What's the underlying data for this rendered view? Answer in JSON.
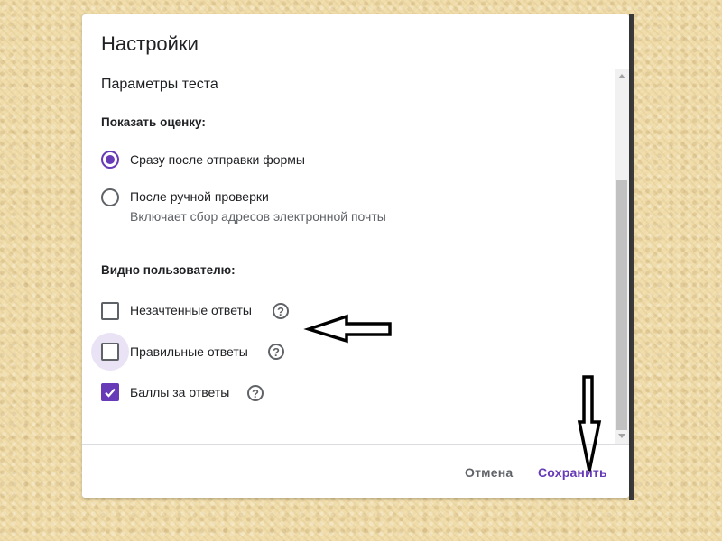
{
  "dialog": {
    "title": "Настройки",
    "section_title": "Параметры теста",
    "show_grade": {
      "label": "Показать оценку:",
      "options": [
        {
          "label": "Сразу после отправки формы",
          "checked": true
        },
        {
          "label": "После ручной проверки",
          "sub": "Включает сбор адресов электронной почты",
          "checked": false
        }
      ]
    },
    "visible_to_user": {
      "label": "Видно пользователю:",
      "options": [
        {
          "label": "Незачтенные ответы",
          "checked": false
        },
        {
          "label": "Правильные ответы",
          "checked": false,
          "focused": true
        },
        {
          "label": "Баллы за ответы",
          "checked": true
        }
      ]
    },
    "help_glyph": "?",
    "buttons": {
      "cancel": "Отмена",
      "save": "Сохранить"
    }
  },
  "colors": {
    "accent": "#673ab7",
    "text": "#202124",
    "muted": "#5f6368"
  },
  "icons": [
    "radio-checked-icon",
    "radio-unchecked-icon",
    "checkbox-icon",
    "checkmark-icon",
    "help-icon",
    "scroll-up-icon",
    "scroll-down-icon",
    "arrow-left-annotation-icon",
    "arrow-down-annotation-icon"
  ]
}
